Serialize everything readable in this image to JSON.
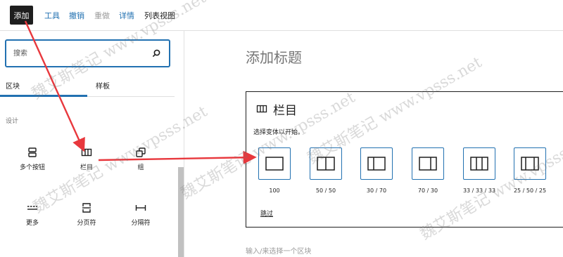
{
  "toolbar": {
    "add_label": "添加",
    "tools_label": "工具",
    "undo_label": "撤销",
    "redo_label": "重做",
    "details_label": "详情",
    "list_view_label": "列表视图"
  },
  "sidebar": {
    "search_placeholder": "搜索",
    "tabs": [
      {
        "label": "区块",
        "active": true
      },
      {
        "label": "样板",
        "active": false
      }
    ],
    "section_title": "设计",
    "blocks": [
      {
        "label": "多个按钮",
        "icon": "buttons-icon"
      },
      {
        "label": "栏目",
        "icon": "columns-icon"
      },
      {
        "label": "组",
        "icon": "group-icon"
      },
      {
        "label": "更多",
        "icon": "more-icon"
      },
      {
        "label": "分页符",
        "icon": "page-break-icon"
      },
      {
        "label": "分隔符",
        "icon": "separator-icon"
      }
    ]
  },
  "editor": {
    "page_title": "添加标题",
    "placeholder": {
      "title": "栏目",
      "instructions": "选择变体以开始。",
      "variations": [
        "100",
        "50 / 50",
        "30 / 70",
        "70 / 30",
        "33 / 33 / 33",
        "25 / 50 / 25"
      ],
      "skip_label": "跳过"
    },
    "append_hint": "输入/来选择一个区块"
  },
  "watermark_text": "魏艾斯笔记 www.vpsss.net",
  "colors": {
    "accent": "#2271b1",
    "annotation_arrow": "#e8383d",
    "add_button_bg": "#1e1e1e"
  }
}
